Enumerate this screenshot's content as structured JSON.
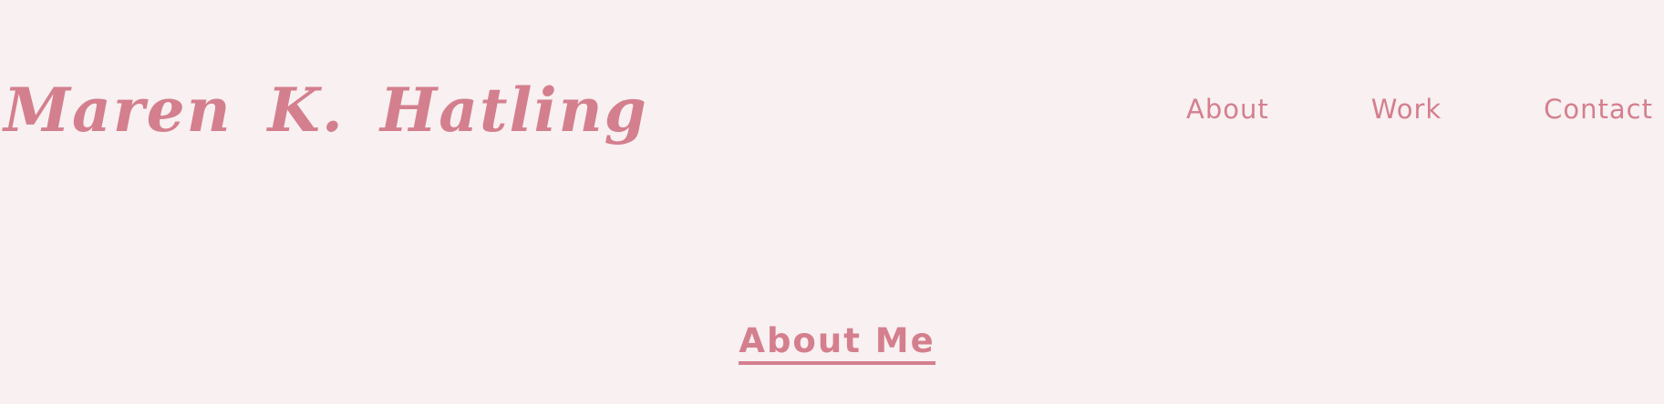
{
  "header": {
    "site_name": "Maren K. Hatling",
    "nav": {
      "about": "About",
      "work": "Work",
      "contact": "Contact"
    }
  },
  "main": {
    "section_title": "About Me"
  },
  "colors": {
    "background": "#f8f0f1",
    "accent": "#d47f8e"
  }
}
